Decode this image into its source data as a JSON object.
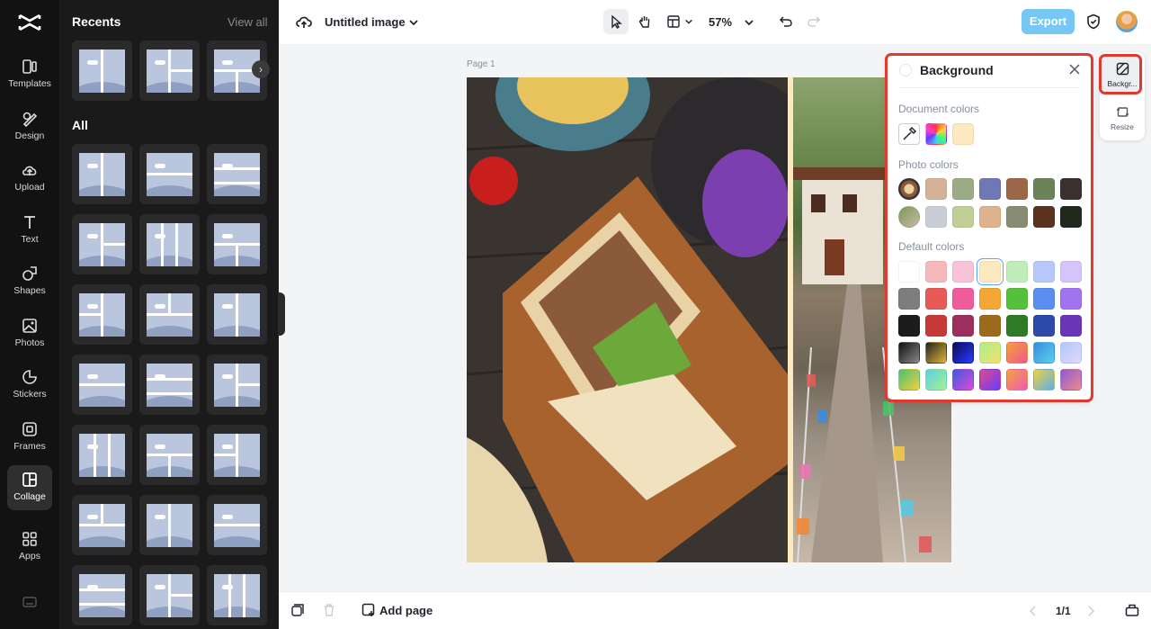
{
  "rail": {
    "items": [
      {
        "label": "Templates",
        "icon": "templates-icon"
      },
      {
        "label": "Design",
        "icon": "design-icon"
      },
      {
        "label": "Upload",
        "icon": "upload-icon"
      },
      {
        "label": "Text",
        "icon": "text-icon"
      },
      {
        "label": "Shapes",
        "icon": "shapes-icon"
      },
      {
        "label": "Photos",
        "icon": "photos-icon"
      },
      {
        "label": "Stickers",
        "icon": "stickers-icon"
      },
      {
        "label": "Frames",
        "icon": "frames-icon"
      },
      {
        "label": "Collage",
        "icon": "collage-icon",
        "active": true
      },
      {
        "label": "Apps",
        "icon": "apps-icon"
      }
    ]
  },
  "panel": {
    "recents_title": "Recents",
    "view_all": "View all",
    "all_title": "All"
  },
  "topbar": {
    "title": "Untitled image",
    "zoom": "57%",
    "export_label": "Export"
  },
  "canvas": {
    "page_label": "Page 1",
    "background_color": "#fde9c0"
  },
  "bottombar": {
    "add_page": "Add page",
    "page_count": "1/1"
  },
  "rightrail": {
    "background_label": "Backgr...",
    "resize_label": "Resize"
  },
  "bgpanel": {
    "title": "Background",
    "document_colors_label": "Document colors",
    "photo_colors_label": "Photo colors",
    "default_colors_label": "Default colors",
    "document_colors": [
      "gradient-multicolor",
      "#fde9c0"
    ],
    "photo_colors": [
      [
        "#d4b29a",
        "#9aab86",
        "#6f77b4",
        "#9c6748",
        "#6c8259",
        "#3a302e"
      ],
      [
        "#c9ced6",
        "#bfcf96",
        "#deb28d",
        "#8a8b73",
        "#5b3220",
        "#1f2a1d"
      ]
    ],
    "default_colors": [
      [
        "#ffffff",
        "#f6b9b9",
        "#f8c2d8",
        "#fde9c0",
        "#bfeebb",
        "#b7c9fb",
        "#d5c4fb"
      ],
      [
        "#7d7d7d",
        "#e65b58",
        "#ef5b9c",
        "#f3a634",
        "#55c03a",
        "#5b8ef2",
        "#a173f0"
      ],
      [
        "#1c1c1c",
        "#c53a37",
        "#9c2f5e",
        "#9b6a1c",
        "#2f7a24",
        "#2d4aa8",
        "#6a36b8"
      ]
    ],
    "selected_color": "#fde9c0"
  }
}
